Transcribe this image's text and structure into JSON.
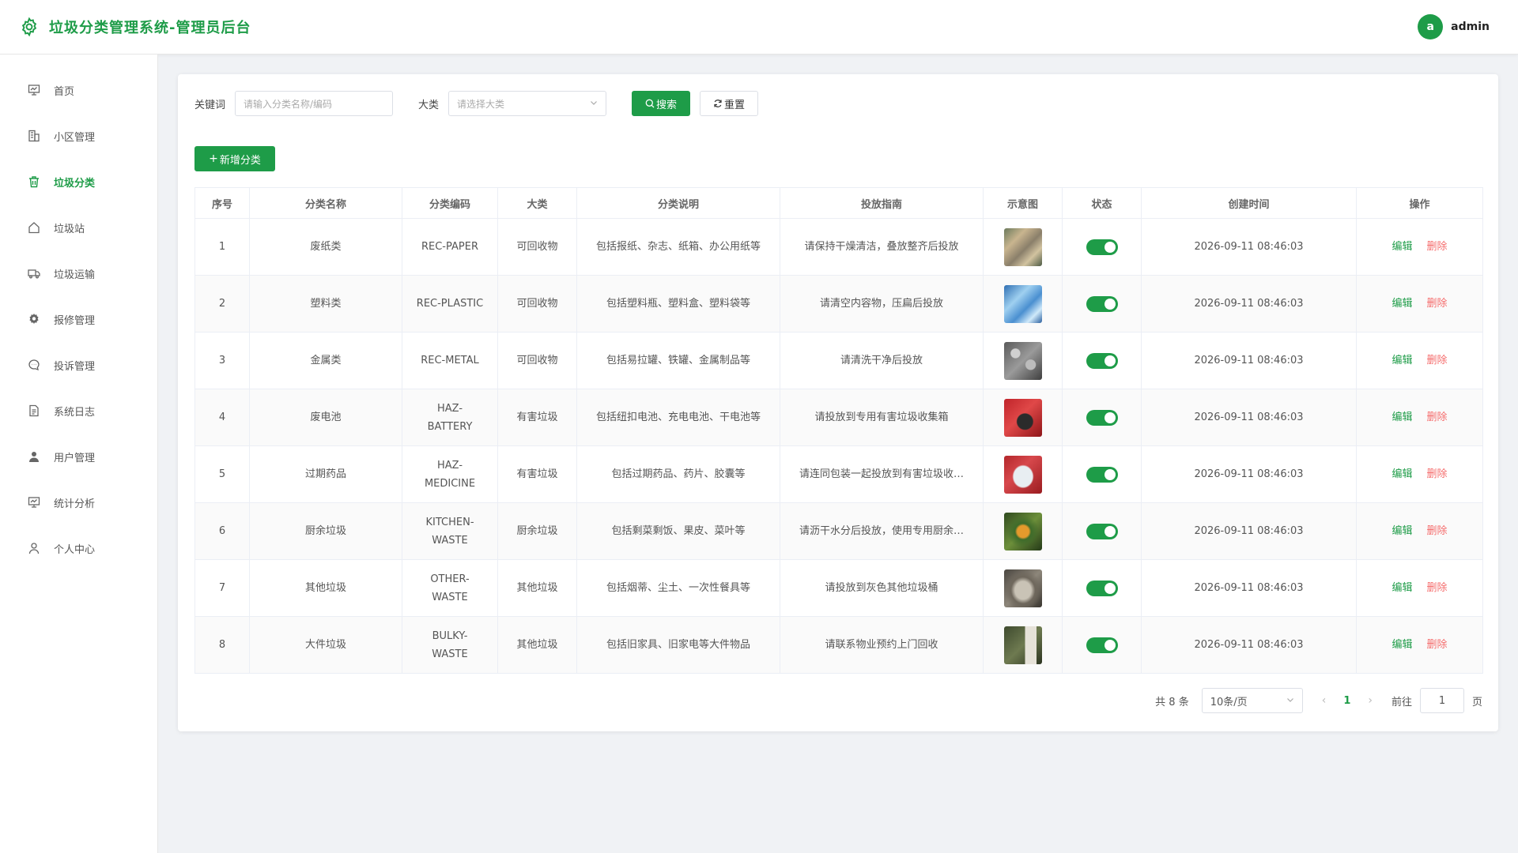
{
  "header": {
    "title": "垃圾分类管理系统-管理员后台",
    "user": {
      "avatar_letter": "a",
      "name": "admin"
    },
    "brand_color": "#1e9c48"
  },
  "sidebar": {
    "items": [
      {
        "label": "首页",
        "icon": "dashboard-icon",
        "active": false
      },
      {
        "label": "小区管理",
        "icon": "building-icon",
        "active": false
      },
      {
        "label": "垃圾分类",
        "icon": "trash-icon",
        "active": true
      },
      {
        "label": "垃圾站",
        "icon": "house-icon",
        "active": false
      },
      {
        "label": "垃圾运输",
        "icon": "truck-icon",
        "active": false
      },
      {
        "label": "报修管理",
        "icon": "gear-icon",
        "active": false
      },
      {
        "label": "投诉管理",
        "icon": "chat-icon",
        "active": false
      },
      {
        "label": "系统日志",
        "icon": "document-icon",
        "active": false
      },
      {
        "label": "用户管理",
        "icon": "user-solid-icon",
        "active": false
      },
      {
        "label": "统计分析",
        "icon": "chart-icon",
        "active": false
      },
      {
        "label": "个人中心",
        "icon": "user-outline-icon",
        "active": false
      }
    ]
  },
  "filters": {
    "keyword_label": "关键词",
    "keyword_placeholder": "请输入分类名称/编码",
    "category_label": "大类",
    "category_placeholder": "请选择大类",
    "search_label": "搜索",
    "reset_label": "重置"
  },
  "toolbar": {
    "add_label": "新增分类"
  },
  "table": {
    "columns": [
      "序号",
      "分类名称",
      "分类编码",
      "大类",
      "分类说明",
      "投放指南",
      "示意图",
      "状态",
      "创建时间",
      "操作"
    ],
    "edit_label": "编辑",
    "delete_label": "删除",
    "rows": [
      {
        "no": "1",
        "name": "废纸类",
        "code_1": "REC-PAPER",
        "code_2": "",
        "major": "可回收物",
        "desc": "包括报纸、杂志、纸箱、办公用纸等",
        "guide": "请保持干燥清洁，叠放整齐后投放",
        "status_on": true,
        "created": "2026-09-11 08:46:03",
        "thumb": "paper-thumbnail"
      },
      {
        "no": "2",
        "name": "塑料类",
        "code_1": "REC-PLASTIC",
        "code_2": "",
        "major": "可回收物",
        "desc": "包括塑料瓶、塑料盒、塑料袋等",
        "guide": "请清空内容物，压扁后投放",
        "status_on": true,
        "created": "2026-09-11 08:46:03",
        "thumb": "plastic-thumbnail"
      },
      {
        "no": "3",
        "name": "金属类",
        "code_1": "REC-METAL",
        "code_2": "",
        "major": "可回收物",
        "desc": "包括易拉罐、铁罐、金属制品等",
        "guide": "请清洗干净后投放",
        "status_on": true,
        "created": "2026-09-11 08:46:03",
        "thumb": "metal-thumbnail"
      },
      {
        "no": "4",
        "name": "废电池",
        "code_1": "HAZ-",
        "code_2": "BATTERY",
        "major": "有害垃圾",
        "desc": "包括纽扣电池、充电电池、干电池等",
        "guide": "请投放到专用有害垃圾收集箱",
        "status_on": true,
        "created": "2026-09-11 08:46:03",
        "thumb": "battery-thumbnail"
      },
      {
        "no": "5",
        "name": "过期药品",
        "code_1": "HAZ-",
        "code_2": "MEDICINE",
        "major": "有害垃圾",
        "desc": "包括过期药品、药片、胶囊等",
        "guide": "请连同包装一起投放到有害垃圾收…",
        "status_on": true,
        "created": "2026-09-11 08:46:03",
        "thumb": "medicine-thumbnail"
      },
      {
        "no": "6",
        "name": "厨余垃圾",
        "code_1": "KITCHEN-",
        "code_2": "WASTE",
        "major": "厨余垃圾",
        "desc": "包括剩菜剩饭、果皮、菜叶等",
        "guide": "请沥干水分后投放，使用专用厨余…",
        "status_on": true,
        "created": "2026-09-11 08:46:03",
        "thumb": "kitchen-thumbnail"
      },
      {
        "no": "7",
        "name": "其他垃圾",
        "code_1": "OTHER-",
        "code_2": "WASTE",
        "major": "其他垃圾",
        "desc": "包括烟蒂、尘土、一次性餐具等",
        "guide": "请投放到灰色其他垃圾桶",
        "status_on": true,
        "created": "2026-09-11 08:46:03",
        "thumb": "other-thumbnail"
      },
      {
        "no": "8",
        "name": "大件垃圾",
        "code_1": "BULKY-",
        "code_2": "WASTE",
        "major": "其他垃圾",
        "desc": "包括旧家具、旧家电等大件物品",
        "guide": "请联系物业预约上门回收",
        "status_on": true,
        "created": "2026-09-11 08:46:03",
        "thumb": "bulky-thumbnail"
      }
    ]
  },
  "pagination": {
    "total_text": "共 8 条",
    "page_size": "10条/页",
    "current_page": "1",
    "goto_label": "前往",
    "goto_value": "1",
    "page_suffix": "页"
  }
}
